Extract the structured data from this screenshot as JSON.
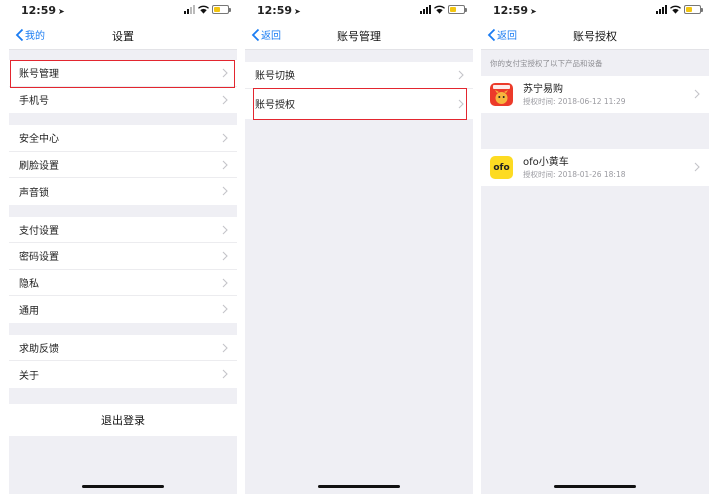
{
  "status_bar": {
    "time": "12:59"
  },
  "screen1": {
    "back_label": "我的",
    "title": "设置",
    "groups": [
      [
        "账号管理",
        "手机号"
      ],
      [
        "安全中心",
        "刷脸设置",
        "声音锁"
      ],
      [
        "支付设置",
        "密码设置",
        "隐私",
        "通用"
      ],
      [
        "求助反馈",
        "关于"
      ]
    ],
    "logout_label": "退出登录"
  },
  "screen2": {
    "back_label": "返回",
    "title": "账号管理",
    "items": [
      "账号切换",
      "账号授权"
    ]
  },
  "screen3": {
    "back_label": "返回",
    "title": "账号授权",
    "hint": "你的支付宝授权了以下产品和设备",
    "apps": [
      {
        "name": "苏宁易购",
        "time": "授权时间: 2018-06-12 11:29",
        "logo_text": "苏宁易购"
      },
      {
        "name": "ofo小黄车",
        "time": "授权时间: 2018-01-26 18:18",
        "logo_text": "ofo"
      }
    ]
  },
  "colors": {
    "accent": "#1a7cf2",
    "highlight": "#e3262f",
    "background": "#efeff4",
    "suning": "#ec3b2a",
    "ofo": "#fddb22"
  },
  "icons": [
    "location-arrow-icon",
    "signal-icon",
    "wifi-icon",
    "battery-icon",
    "chevron-left-icon",
    "chevron-right-icon"
  ]
}
